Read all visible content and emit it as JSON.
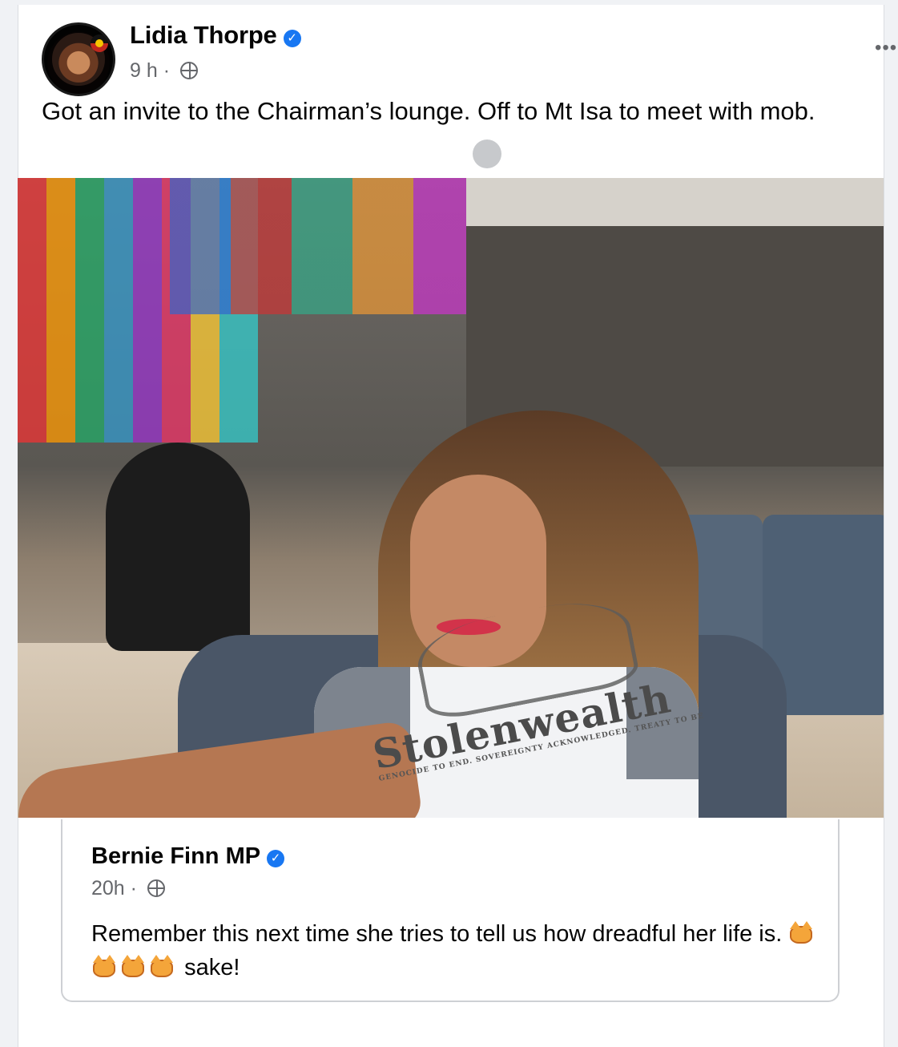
{
  "post": {
    "author": "Lidia Thorpe",
    "time": "9 h",
    "text": "Got an invite to the Chairman’s lounge. Off to Mt Isa to meet with mob.",
    "more": "•••"
  },
  "photo": {
    "shirt_text": "Stolenwealth",
    "shirt_subtext": "GENOCIDE TO END. SOVEREIGNTY ACKNOWLEDGED. TREATY TO BE"
  },
  "shared_post": {
    "author": "Bernie Finn MP",
    "time": "20h",
    "text_before": "Remember this next time she tries to tell us how dreadful her life is.",
    "text_after": "sake!"
  },
  "icons": {
    "verified": "verified-badge-icon",
    "privacy": "globe-icon",
    "emoji": "pouting-cat-emoji"
  },
  "colors": {
    "verified_blue": "#1877f2",
    "meta_grey": "#65676b",
    "page_bg": "#f0f2f5"
  }
}
